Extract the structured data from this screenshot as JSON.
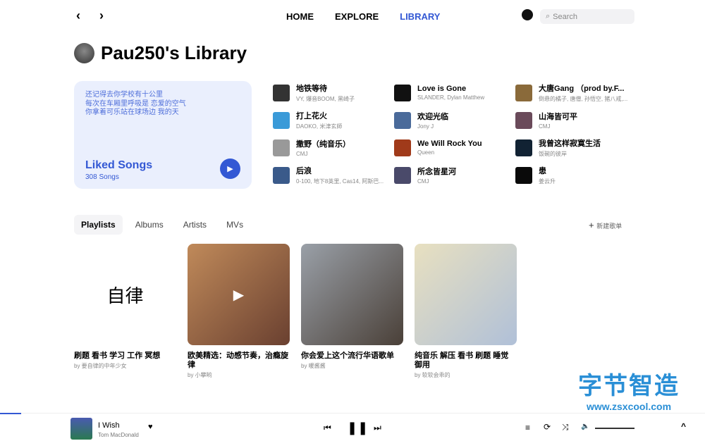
{
  "nav": {
    "back": "‹",
    "forward": "›",
    "links": [
      "HOME",
      "EXPLORE",
      "LIBRARY"
    ],
    "active": "LIBRARY",
    "search_placeholder": "Search"
  },
  "page_title": "Pau250's Library",
  "liked": {
    "lyrics": [
      "还记得去你学校有十公里",
      "每次在车厢里呼吸是 恋爱的空气",
      "你拿着可乐站在球场边 我的天"
    ],
    "title": "Liked Songs",
    "count": "308 Songs"
  },
  "songs": [
    {
      "name": "地铁等待",
      "artist": "VY, 爆音BOOM, 黑崎子",
      "color": "#333"
    },
    {
      "name": "Love is Gone",
      "artist": "SLANDER, Dylan Matthew",
      "color": "#111"
    },
    {
      "name": "大唐Gang （prod by.F...",
      "artist": "倒悬的橘子, 唐僧, 孙悟空, 猪八戒,...",
      "color": "#8a6a3a"
    },
    {
      "name": "打上花火",
      "artist": "DAOKO, 米津玄師",
      "color": "#3a9ad8"
    },
    {
      "name": "欢迎光临",
      "artist": "Jony J",
      "color": "#4a6a9a"
    },
    {
      "name": "山海皆可平",
      "artist": "CMJ",
      "color": "#6a4a5a"
    },
    {
      "name": "撒野（纯音乐）",
      "artist": "CMJ",
      "color": "#999"
    },
    {
      "name": "We Will Rock You",
      "artist": "Queen",
      "color": "#a03a1a"
    },
    {
      "name": "我曾这样寂寞生活",
      "artist": "饭碗的彼岸",
      "color": "#123"
    },
    {
      "name": "后浪",
      "artist": "0-100, 地下8英里, Cas14, 阿斯巴...",
      "color": "#3a5a8a"
    },
    {
      "name": "所念皆星河",
      "artist": "CMJ",
      "color": "#4a4a6a"
    },
    {
      "name": "患",
      "artist": "姜云升",
      "color": "#0a0a0a"
    }
  ],
  "tabs": [
    "Playlists",
    "Albums",
    "Artists",
    "MVs"
  ],
  "active_tab": "Playlists",
  "new_playlist": "新建歌单",
  "playlists": [
    {
      "name": "刷题 看书 学习 工作 冥想",
      "by": "by 要自律的中年少女",
      "cover_text": "自律",
      "bg": "#fff"
    },
    {
      "name": "欧美精选：动感节奏，治瘾旋律",
      "by": "by 小攀哟",
      "bg": "linear-gradient(135deg,#c08a5a,#6a4030)"
    },
    {
      "name": "你会爱上这个流行华语歌单",
      "by": "by 暖酱酱",
      "bg": "linear-gradient(135deg,#9aa0a8,#4a4038)"
    },
    {
      "name": "纯音乐 解压 看书 刷题 睡觉 御用",
      "by": "by 软软会乖的",
      "bg": "linear-gradient(135deg,#e8e0c0,#b0c0d8)"
    }
  ],
  "player": {
    "title": "I Wish",
    "artist": "Tom MacDonald",
    "progress": 0.03
  },
  "watermark": {
    "line1": "字节智造",
    "line2": "www.zsxcool.com"
  }
}
